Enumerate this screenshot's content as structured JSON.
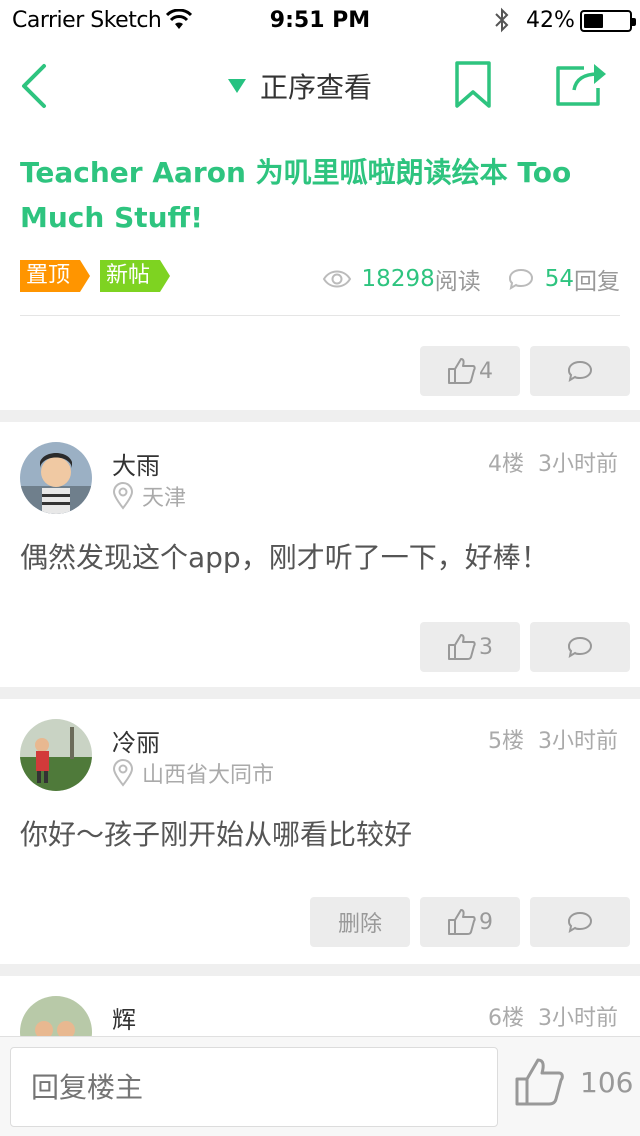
{
  "status_bar": {
    "carrier": "Carrier Sketch",
    "time": "9:51 PM",
    "battery": "42%"
  },
  "nav": {
    "sort_label": "正序查看",
    "back_icon": "chevron-left-icon",
    "bookmark_icon": "bookmark-icon",
    "share_icon": "share-icon"
  },
  "post": {
    "title": "Teacher Aaron 为叽里呱啦朗读绘本 Too Much Stuff!",
    "tags": [
      "置顶",
      "新帖"
    ],
    "views": "18298",
    "views_unit": "阅读",
    "replies": "54",
    "replies_unit": "回复",
    "likes": "4"
  },
  "replies": [
    {
      "name": "大雨",
      "floor": "4楼",
      "time": "3小时前",
      "location": "天津",
      "body": "偶然发现这个app，刚才听了一下，好棒！",
      "likes": "3"
    },
    {
      "name": "冷丽",
      "floor": "5楼",
      "time": "3小时前",
      "location": "山西省大同市",
      "body": "你好～孩子刚开始从哪看比较好",
      "likes": "9",
      "delete_label": "删除"
    },
    {
      "name": "辉",
      "floor": "6楼",
      "time": "3小时前"
    }
  ],
  "bottom_bar": {
    "placeholder": "回复楼主",
    "likes": "106"
  },
  "colors": {
    "accent": "#2ec47f",
    "tag_top": "#ff9500",
    "tag_new": "#7ed321"
  }
}
